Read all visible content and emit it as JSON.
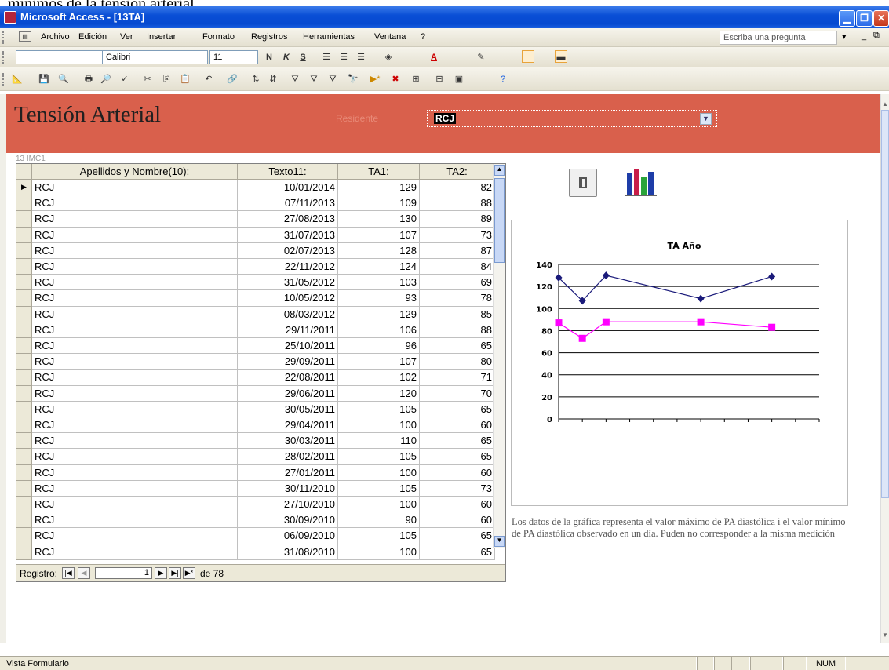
{
  "page_top_text": "mínimos de la tensión arterial.",
  "window": {
    "title": "Microsoft Access - [13TA]"
  },
  "menu": {
    "items": [
      "Archivo",
      "Edición",
      "Ver",
      "Insertar",
      "Formato",
      "Registros",
      "Herramientas",
      "Ventana",
      "?"
    ],
    "ask_placeholder": "Escriba una pregunta"
  },
  "format_toolbar": {
    "object_box": "",
    "font": "Calibri",
    "size": "11",
    "bold": "N",
    "italic": "K",
    "underline": "S"
  },
  "form": {
    "title": "Tensión Arterial",
    "resident_label": "Residente",
    "resident_value": "RCJ",
    "subform_label": "13 IMC1"
  },
  "grid": {
    "columns": [
      "Apellidos y Nombre(10):",
      "Texto11:",
      "TA1:",
      "TA2:"
    ],
    "rows": [
      [
        "RCJ",
        "10/01/2014",
        "129",
        "82"
      ],
      [
        "RCJ",
        "07/11/2013",
        "109",
        "88"
      ],
      [
        "RCJ",
        "27/08/2013",
        "130",
        "89"
      ],
      [
        "RCJ",
        "31/07/2013",
        "107",
        "73"
      ],
      [
        "RCJ",
        "02/07/2013",
        "128",
        "87"
      ],
      [
        "RCJ",
        "22/11/2012",
        "124",
        "84"
      ],
      [
        "RCJ",
        "31/05/2012",
        "103",
        "69"
      ],
      [
        "RCJ",
        "10/05/2012",
        "93",
        "78"
      ],
      [
        "RCJ",
        "08/03/2012",
        "129",
        "85"
      ],
      [
        "RCJ",
        "29/11/2011",
        "106",
        "88"
      ],
      [
        "RCJ",
        "25/10/2011",
        "96",
        "65"
      ],
      [
        "RCJ",
        "29/09/2011",
        "107",
        "80"
      ],
      [
        "RCJ",
        "22/08/2011",
        "102",
        "71"
      ],
      [
        "RCJ",
        "29/06/2011",
        "120",
        "70"
      ],
      [
        "RCJ",
        "30/05/2011",
        "105",
        "65"
      ],
      [
        "RCJ",
        "29/04/2011",
        "100",
        "60"
      ],
      [
        "RCJ",
        "30/03/2011",
        "110",
        "65"
      ],
      [
        "RCJ",
        "28/02/2011",
        "105",
        "65"
      ],
      [
        "RCJ",
        "27/01/2011",
        "100",
        "60"
      ],
      [
        "RCJ",
        "30/11/2010",
        "105",
        "73"
      ],
      [
        "RCJ",
        "27/10/2010",
        "100",
        "60"
      ],
      [
        "RCJ",
        "30/09/2010",
        "90",
        "60"
      ],
      [
        "RCJ",
        "06/09/2010",
        "105",
        "65"
      ],
      [
        "RCJ",
        "31/08/2010",
        "100",
        "65"
      ]
    ],
    "nav": {
      "label": "Registro:",
      "current": "1",
      "total": "de 78"
    }
  },
  "note": "Los datos de la gráfica representa el valor máximo de PA diastólica i el valor mínimo de PA diastólica observado en un día. Puden no corresponder a la misma medición",
  "status": {
    "left": "Vista Formulario",
    "num": "NUM"
  },
  "colors": {
    "header": "#d9604c",
    "series1": "#1a1a7a",
    "series2": "#ff00ff"
  },
  "icons": [
    "exit-door-icon",
    "chart-icon"
  ],
  "chart_data": {
    "type": "line",
    "title": "TA Año",
    "ylim": [
      0,
      140
    ],
    "yticks": [
      "0",
      "20",
      "40",
      "60",
      "80",
      "100",
      "120",
      "140"
    ],
    "x_count": 12,
    "series": [
      {
        "name": "",
        "color": "#1a1a7a",
        "marker": "diamond",
        "points": [
          [
            0,
            128
          ],
          [
            1,
            107
          ],
          [
            2,
            130
          ],
          [
            6,
            109
          ],
          [
            9,
            129
          ]
        ]
      },
      {
        "name": "",
        "color": "#ff00ff",
        "marker": "square",
        "points": [
          [
            0,
            87
          ],
          [
            1,
            73
          ],
          [
            2,
            88
          ],
          [
            6,
            88
          ],
          [
            9,
            83
          ]
        ]
      }
    ]
  }
}
